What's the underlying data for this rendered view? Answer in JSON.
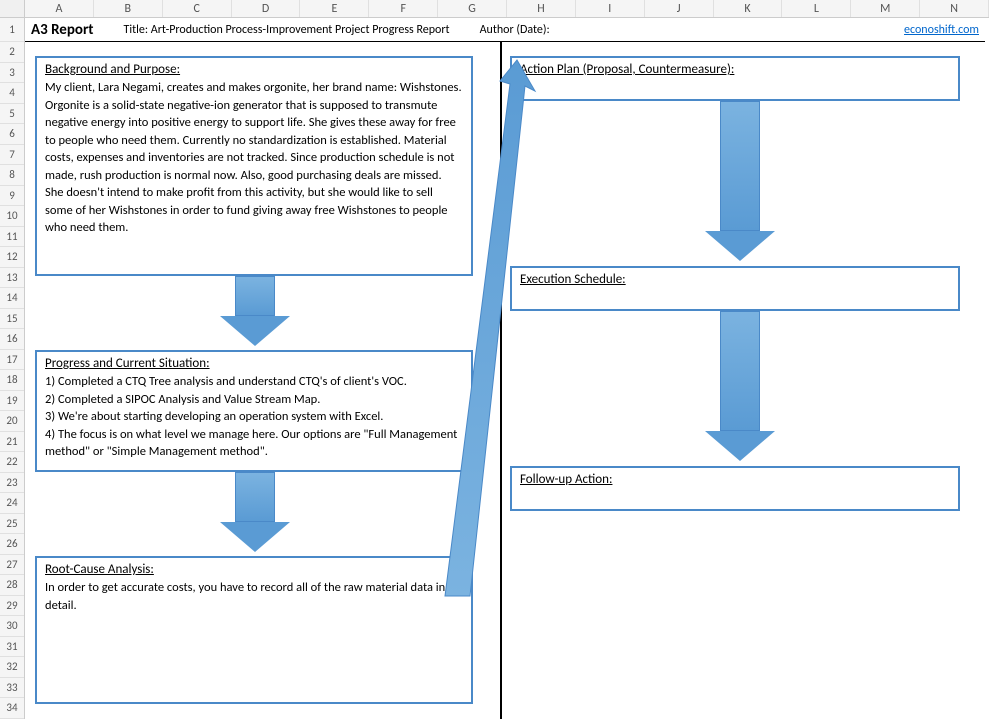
{
  "columns": [
    "A",
    "B",
    "C",
    "D",
    "E",
    "F",
    "G",
    "H",
    "I",
    "J",
    "K",
    "L",
    "M",
    "N"
  ],
  "rows": [
    "1",
    "2",
    "3",
    "4",
    "5",
    "6",
    "7",
    "8",
    "9",
    "10",
    "11",
    "12",
    "13",
    "14",
    "15",
    "16",
    "17",
    "18",
    "19",
    "20",
    "21",
    "22",
    "23",
    "24",
    "25",
    "26",
    "27",
    "28",
    "29",
    "30",
    "31",
    "32",
    "33",
    "34"
  ],
  "header": {
    "report_label": "A3 Report",
    "title_label": "Title: Art-Production Process-Improvement Project Progress Report",
    "author_label": "Author (Date):",
    "link_text": "econoshift.com"
  },
  "boxes": {
    "background": {
      "title": "Background and Purpose:",
      "body": "My client, Lara Negami, creates and makes orgonite, her brand name: Wishstones.  Orgonite is a solid-state negative-ion generator that is supposed to transmute negative energy into positive energy to support life.  She gives these away for free to people who need them.  Currently no standardization is established.  Material costs, expenses and inventories are not tracked.  Since production schedule is not made, rush production is normal now.  Also, good purchasing deals are missed.\nShe doesn't intend to make profit from this activity, but she would like to sell some of her Wishstones in order to fund giving away free Wishstones to people who need them."
    },
    "progress": {
      "title": "Progress and Current Situation:",
      "body": "1) Completed a CTQ Tree analysis and understand CTQ's of client's VOC.\n2) Completed a SIPOC Analysis and Value Stream Map.\n3) We're about starting developing an operation system with Excel.\n4) The focus is on what level we manage here.  Our options are \"Full Management method\" or \"Simple Management method\"."
    },
    "rootcause": {
      "title": "Root-Cause Analysis:",
      "body": "In order to get accurate costs, you have to record all of the raw material data in detail."
    },
    "action": {
      "title": "Action Plan (Proposal, Countermeasure):",
      "body": ""
    },
    "execution": {
      "title": "Execution Schedule:",
      "body": ""
    },
    "followup": {
      "title": "Follow-up Action:",
      "body": ""
    }
  }
}
